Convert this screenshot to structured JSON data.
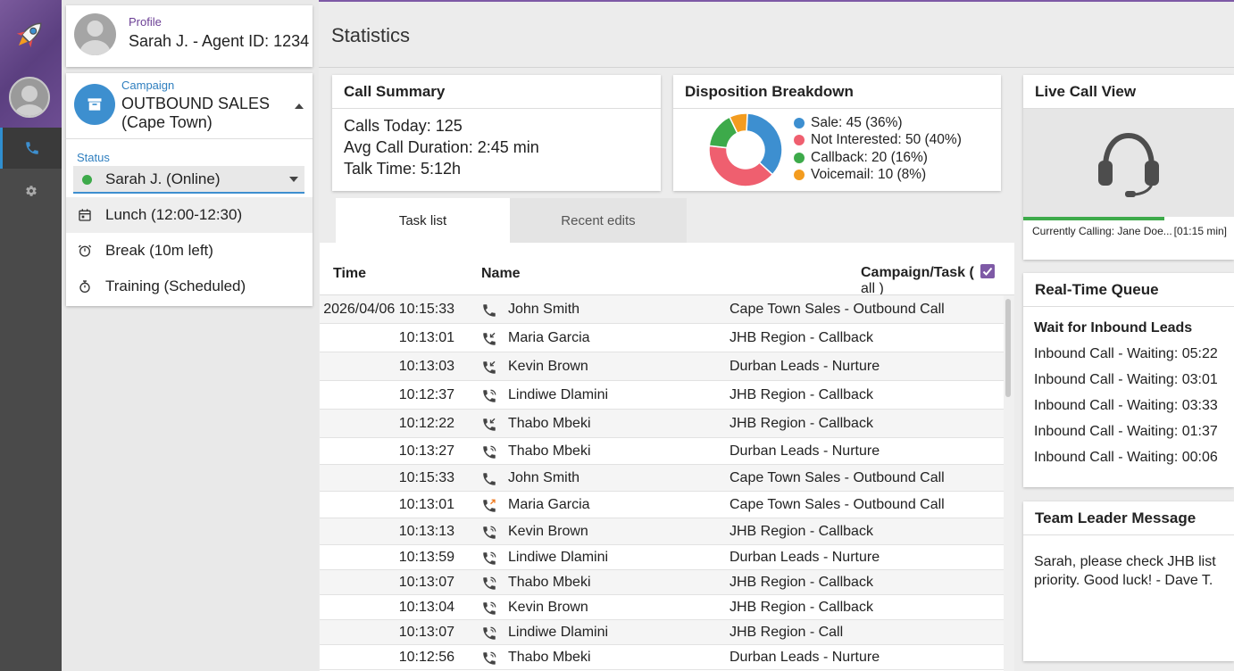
{
  "profile": {
    "label": "Profile",
    "name": "Sarah J. - Agent ID: 1234"
  },
  "campaign": {
    "label": "Campaign",
    "value": "OUTBOUND SALES (Cape Town)"
  },
  "status": {
    "label": "Status",
    "current": "Sarah J. (Online)",
    "options": [
      {
        "label": "Lunch (12:00-12:30)",
        "icon": "calendar-icon"
      },
      {
        "label": "Break (10m left)",
        "icon": "timer-icon"
      },
      {
        "label": "Training (Scheduled)",
        "icon": "stopwatch-icon"
      }
    ]
  },
  "header": {
    "title": "Statistics"
  },
  "call_summary": {
    "title": "Call Summary",
    "lines": [
      "Calls Today: 125",
      "Avg Call Duration: 2:45 min",
      "Talk Time: 5:12h"
    ]
  },
  "disposition": {
    "title": "Disposition Breakdown",
    "legend": [
      {
        "label": "Sale: 45 (36%)",
        "color": "#3d8fd0"
      },
      {
        "label": "Not Interested: 50 (40%)",
        "color": "#ef5f6f"
      },
      {
        "label": "Callback: 20 (16%)",
        "color": "#3daa4a"
      },
      {
        "label": "Voicemail: 10 (8%)",
        "color": "#f39c1f"
      }
    ]
  },
  "chart_data": {
    "type": "pie",
    "categories": [
      "Sale",
      "Not Interested",
      "Callback",
      "Voicemail"
    ],
    "values": [
      45,
      50,
      20,
      10
    ],
    "colors": [
      "#3d8fd0",
      "#ef5f6f",
      "#3daa4a",
      "#f39c1f"
    ],
    "title": "Disposition Breakdown"
  },
  "tabs": [
    {
      "label": "Task list",
      "active": true
    },
    {
      "label": "Recent edits",
      "active": false
    }
  ],
  "table": {
    "headers": {
      "time": "Time",
      "name": "Name",
      "campaign": "Campaign/Task (",
      "all": "all )"
    },
    "rows": [
      {
        "time": "2026/04/06 10:15:33",
        "icon": "phone-icon",
        "name": "John Smith",
        "campaign": "Cape Town Sales - Outbound Call"
      },
      {
        "time": "10:13:01",
        "icon": "phone-incoming-icon",
        "name": "Maria Garcia",
        "campaign": "JHB Region - Callback"
      },
      {
        "time": "10:13:03",
        "icon": "phone-incoming-icon",
        "name": "Kevin Brown",
        "campaign": "Durban Leads - Nurture"
      },
      {
        "time": "10:12:37",
        "icon": "phone-ringing-icon",
        "name": "Lindiwe Dlamini",
        "campaign": "JHB Region - Callback"
      },
      {
        "time": "10:12:22",
        "icon": "phone-incoming-icon",
        "name": "Thabo Mbeki",
        "campaign": "JHB Region - Callback"
      },
      {
        "time": "10:13:27",
        "icon": "phone-ringing-icon",
        "name": "Thabo Mbeki",
        "campaign": "Durban Leads - Nurture"
      },
      {
        "time": "10:15:33",
        "icon": "phone-icon",
        "name": "John Smith",
        "campaign": "Cape Town Sales - Outbound Call"
      },
      {
        "time": "10:13:01",
        "icon": "phone-outgoing-icon",
        "name": "Maria Garcia",
        "campaign": "Cape Town Sales - Outbound Call"
      },
      {
        "time": "10:13:13",
        "icon": "phone-ringing-icon",
        "name": "Kevin Brown",
        "campaign": "JHB Region - Callback"
      },
      {
        "time": "10:13:59",
        "icon": "phone-ringing-icon",
        "name": "Lindiwe Dlamini",
        "campaign": "Durban Leads - Nurture"
      },
      {
        "time": "10:13:07",
        "icon": "phone-ringing-icon",
        "name": "Thabo Mbeki",
        "campaign": "JHB Region - Callback"
      },
      {
        "time": "10:13:04",
        "icon": "phone-ringing-icon",
        "name": "Kevin Brown",
        "campaign": "JHB Region - Callback"
      },
      {
        "time": "10:13:07",
        "icon": "phone-ringing-icon",
        "name": "Lindiwe Dlamini",
        "campaign": "JHB Region - Call"
      },
      {
        "time": "10:12:56",
        "icon": "phone-ringing-icon",
        "name": "Thabo Mbeki",
        "campaign": "Durban Leads - Nurture"
      }
    ]
  },
  "live_call": {
    "title": "Live Call View",
    "calling": "Currently Calling: Jane Doe...",
    "duration": "[01:15 min]",
    "progress": 0.67
  },
  "queue": {
    "title": "Real-Time Queue",
    "heading": "Wait for Inbound Leads",
    "items": [
      "Inbound Call - Waiting: 05:22",
      "Inbound Call - Waiting: 03:01",
      "Inbound Call - Waiting: 03:33",
      "Inbound Call - Waiting: 01:37",
      "Inbound Call - Waiting: 00:06"
    ]
  },
  "team_message": {
    "title": "Team Leader Message",
    "text": "Sarah, please check JHB list priority. Good luck! - Dave T."
  },
  "colors": {
    "accent_purple": "#7e5aa6",
    "accent_blue": "#3d8fcf",
    "online_green": "#3daa4a"
  }
}
